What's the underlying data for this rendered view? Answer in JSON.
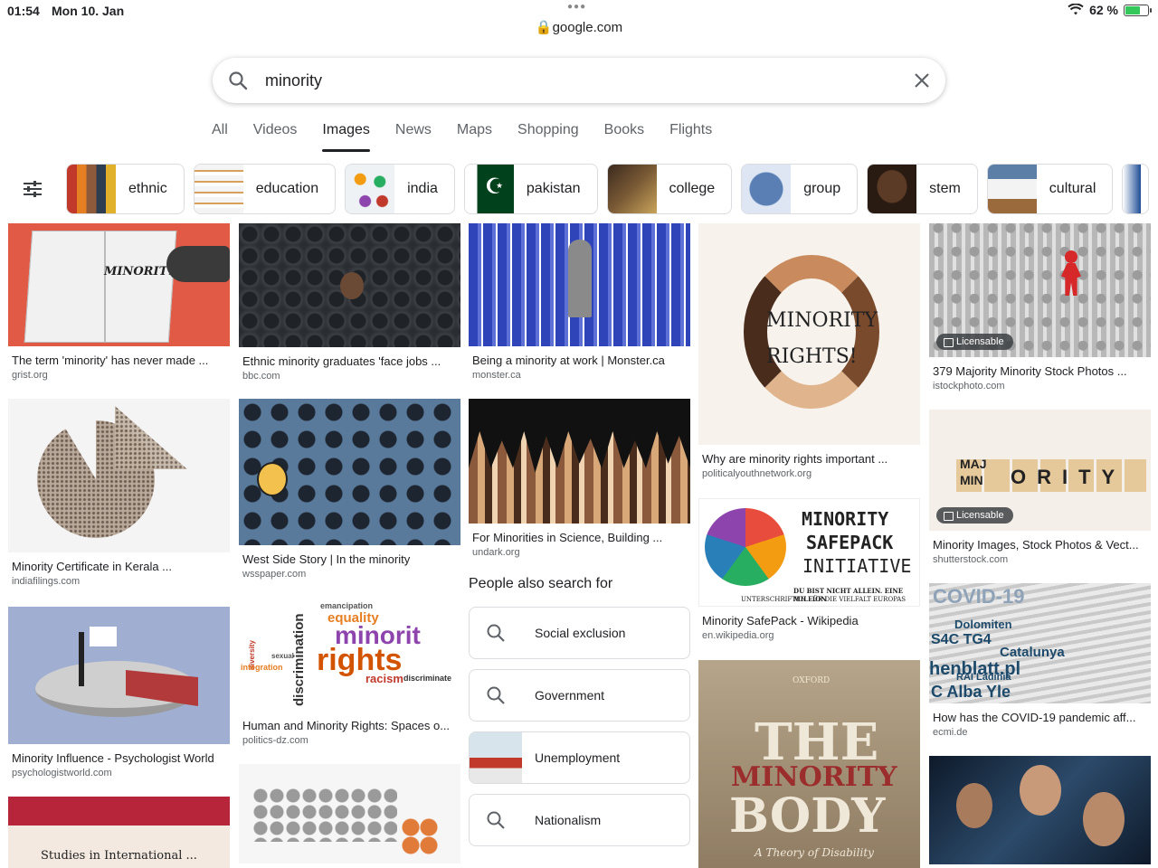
{
  "status_bar": {
    "time": "01:54",
    "date": "Mon 10. Jan",
    "battery": "62 %",
    "url": "google.com",
    "battery_level": 0.62
  },
  "search": {
    "query": "minority"
  },
  "tabs": [
    {
      "label": "All"
    },
    {
      "label": "Videos"
    },
    {
      "label": "Images"
    },
    {
      "label": "News"
    },
    {
      "label": "Maps"
    },
    {
      "label": "Shopping"
    },
    {
      "label": "Books"
    },
    {
      "label": "Flights"
    }
  ],
  "chips": [
    {
      "label": "ethnic"
    },
    {
      "label": "education"
    },
    {
      "label": "india"
    },
    {
      "label": "pakistan"
    },
    {
      "label": "college"
    },
    {
      "label": "group"
    },
    {
      "label": "stem"
    },
    {
      "label": "cultural"
    }
  ],
  "results": {
    "c1": [
      {
        "caption": "The term 'minority' has never made ...",
        "domain": "grist.org",
        "image_text": "MINORITY"
      },
      {
        "caption": "Minority Certificate in Kerala ...",
        "domain": "indiafilings.com"
      },
      {
        "caption": "Minority Influence - Psychologist World",
        "domain": "psychologistworld.com"
      },
      {
        "caption": "",
        "domain": "",
        "image_text": "Studies in International ..."
      }
    ],
    "c2": [
      {
        "caption": "Ethnic minority graduates 'face jobs ...",
        "domain": "bbc.com"
      },
      {
        "caption": "West Side Story | In the minority",
        "domain": "wsspaper.com"
      },
      {
        "caption": "Human and Minority Rights: Spaces o...",
        "domain": "politics-dz.com"
      }
    ],
    "c3": [
      {
        "caption": "Being a minority at work | Monster.ca",
        "domain": "monster.ca"
      },
      {
        "caption": "For Minorities in Science, Building ...",
        "domain": "undark.org"
      }
    ],
    "c4": [
      {
        "caption": "Why are minority rights important ...",
        "domain": "politicalyouthnetwork.org",
        "image_text": "MINORITY RIGHTS!"
      },
      {
        "caption": "Minority SafePack - Wikipedia",
        "domain": "en.wikipedia.org"
      },
      {
        "caption": "",
        "domain": ""
      }
    ],
    "c5": [
      {
        "caption": "379 Majority Minority Stock Photos ...",
        "domain": "istockphoto.com",
        "badge": "Licensable"
      },
      {
        "caption": "Minority Images, Stock Photos & Vect...",
        "domain": "shutterstock.com",
        "badge": "Licensable"
      },
      {
        "caption": "How has the COVID-19 pandemic aff...",
        "domain": "ecmi.de"
      },
      {
        "caption": "",
        "domain": ""
      }
    ]
  },
  "people_also_search": {
    "title": "People also search for",
    "items": [
      {
        "label": "Social exclusion"
      },
      {
        "label": "Government"
      },
      {
        "label": "Unemployment"
      },
      {
        "label": "Nationalism"
      }
    ]
  },
  "image_texts": {
    "rights_cloud": [
      "emancipation",
      "equality",
      "minorit",
      "rights",
      "discrimination",
      "racism",
      "discriminate",
      "diversity",
      "integration",
      "sexual"
    ],
    "safepack": [
      "MINORITY",
      "SAFEPACK",
      "INITIATIVE",
      "DU BIST NICHT ALLEIN. EINE MILLION",
      "UNTERSCHRIFTEN FÜR DIE VIELFALT EUROPAS"
    ],
    "book": [
      "OXFORD",
      "THE",
      "MINORITY",
      "BODY",
      "A Theory of Disability"
    ],
    "blocks": [
      "MAJ",
      "MIN",
      "ORITY"
    ],
    "newspaper": [
      "COVID-19",
      "Dolomiten",
      "S4C TG4",
      "Catalunya",
      "henblatt.pl",
      "RAI Ladinia",
      "C Alba Yle"
    ]
  },
  "colors": {
    "accent": "#202124",
    "muted": "#5f6368",
    "border": "#dadce0"
  }
}
